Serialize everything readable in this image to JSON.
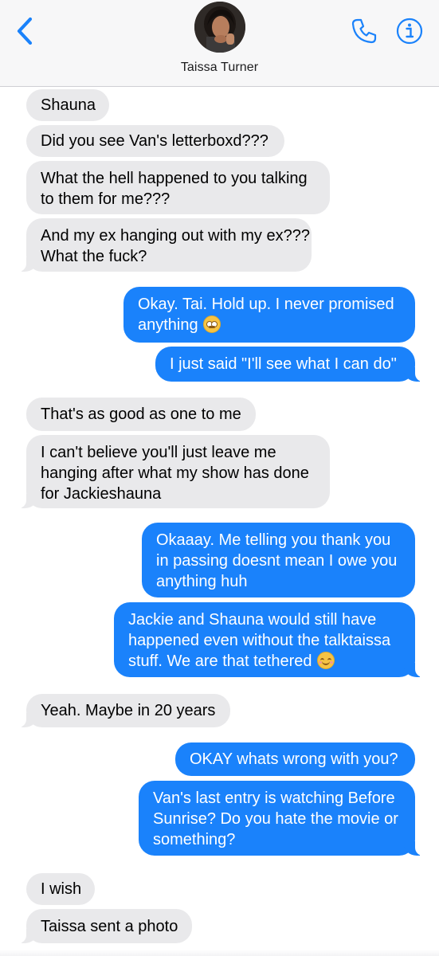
{
  "header": {
    "contact_name": "Taissa Turner",
    "back_icon": "chevron-left-icon",
    "call_icon": "phone-icon",
    "info_icon": "info-icon",
    "accent_color": "#1a82fb"
  },
  "messages": [
    {
      "id": "m1",
      "direction": "incoming",
      "text": "Shauna"
    },
    {
      "id": "m2",
      "direction": "incoming",
      "text": "Did you see Van's letterboxd???"
    },
    {
      "id": "m3",
      "direction": "incoming",
      "lines": [
        "What the hell happened to you talking",
        "to them for me???"
      ]
    },
    {
      "id": "m4",
      "direction": "incoming",
      "lines": [
        "And my ex hanging out with my ex???",
        "What the fuck?"
      ]
    },
    {
      "id": "m5",
      "direction": "outgoing",
      "lines": [
        "Okay. Tai. Hold up.  I never promised",
        "anything"
      ],
      "emoji": "face-with-rolling-eyes"
    },
    {
      "id": "m6",
      "direction": "outgoing",
      "text": "I just said \"I'll see what I can do\""
    },
    {
      "id": "m7",
      "direction": "incoming",
      "text": "That's as good as one to me"
    },
    {
      "id": "m8",
      "direction": "incoming",
      "lines": [
        "I can't believe you'll just leave me",
        "hanging after what my show has done",
        "for Jackieshauna"
      ]
    },
    {
      "id": "m9",
      "direction": "outgoing",
      "lines": [
        "Okaaay. Me telling you thank you",
        "in passing doesnt mean I owe you",
        "anything huh"
      ]
    },
    {
      "id": "m10",
      "direction": "outgoing",
      "lines": [
        "Jackie and Shauna would still have",
        "happened even without the talktaissa",
        "stuff. We are that tethered"
      ],
      "emoji": "smiling-face-with-smiling-eyes"
    },
    {
      "id": "m11",
      "direction": "incoming",
      "text": "Yeah. Maybe in 20 years"
    },
    {
      "id": "m12",
      "direction": "outgoing",
      "text": "OKAY whats wrong with you?"
    },
    {
      "id": "m13",
      "direction": "outgoing",
      "lines": [
        "Van's last entry is watching Before",
        "Sunrise? Do you hate the movie or",
        "something?"
      ]
    },
    {
      "id": "m14",
      "direction": "incoming",
      "text": "I wish"
    },
    {
      "id": "m15",
      "direction": "incoming",
      "text": "Taissa sent a photo"
    }
  ],
  "colors": {
    "incoming_bubble": "#e9e9eb",
    "outgoing_bubble": "#1a82fb",
    "header_bg": "#f7f7f8"
  }
}
